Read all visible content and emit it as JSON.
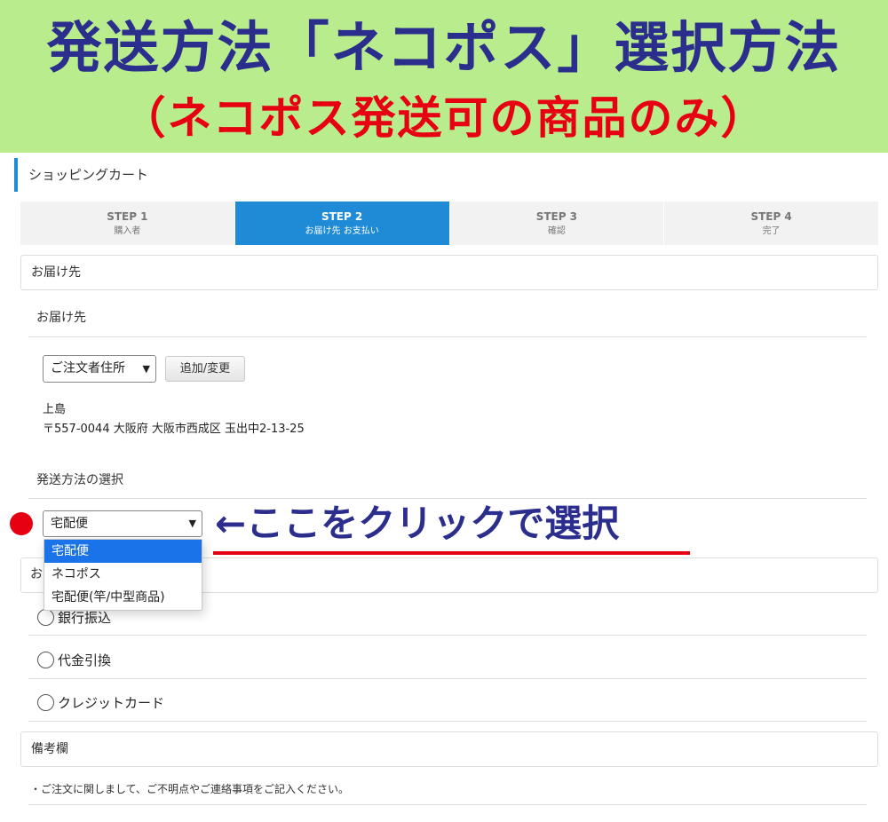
{
  "banner": {
    "title": "発送方法「ネコポス」選択方法",
    "subtitle": "（ネコポス発送可の商品のみ）"
  },
  "page": {
    "heading": "ショッピングカート"
  },
  "steps": [
    {
      "num": "STEP 1",
      "label": "購入者"
    },
    {
      "num": "STEP 2",
      "label": "お届け先 お支払い"
    },
    {
      "num": "STEP 3",
      "label": "確認"
    },
    {
      "num": "STEP 4",
      "label": "完了"
    }
  ],
  "delivery": {
    "section_title": "お届け先",
    "sub_title": "お届け先",
    "address_select_value": "ご注文者住所",
    "add_change_button": "追加/変更",
    "name": "上島",
    "address": "〒557-0044 大阪府 大阪市西成区 玉出中2-13-25"
  },
  "shipping": {
    "sub_title": "発送方法の選択",
    "select_value": "宅配便",
    "options": [
      "宅配便",
      "ネコポス",
      "宅配便(竿/中型商品)"
    ]
  },
  "annotation": {
    "text": "←ここをクリックで選択"
  },
  "payment": {
    "section_title_partial": "お",
    "options": [
      "銀行振込",
      "代金引換",
      "クレジットカード"
    ]
  },
  "remarks": {
    "section_title": "備考欄",
    "note": "・ご注文に関しまして、ご不明点やご連絡事項をご記入ください。"
  },
  "icons": {
    "select_arrow": "chevron-down-icon",
    "marker": "red-dot-marker"
  },
  "colors": {
    "accent": "#1f8bd6",
    "banner_bg": "#b8ec8c",
    "banner_title": "#2b2e8c",
    "highlight_red": "#e60012",
    "dropdown_selected": "#1a73e8"
  }
}
